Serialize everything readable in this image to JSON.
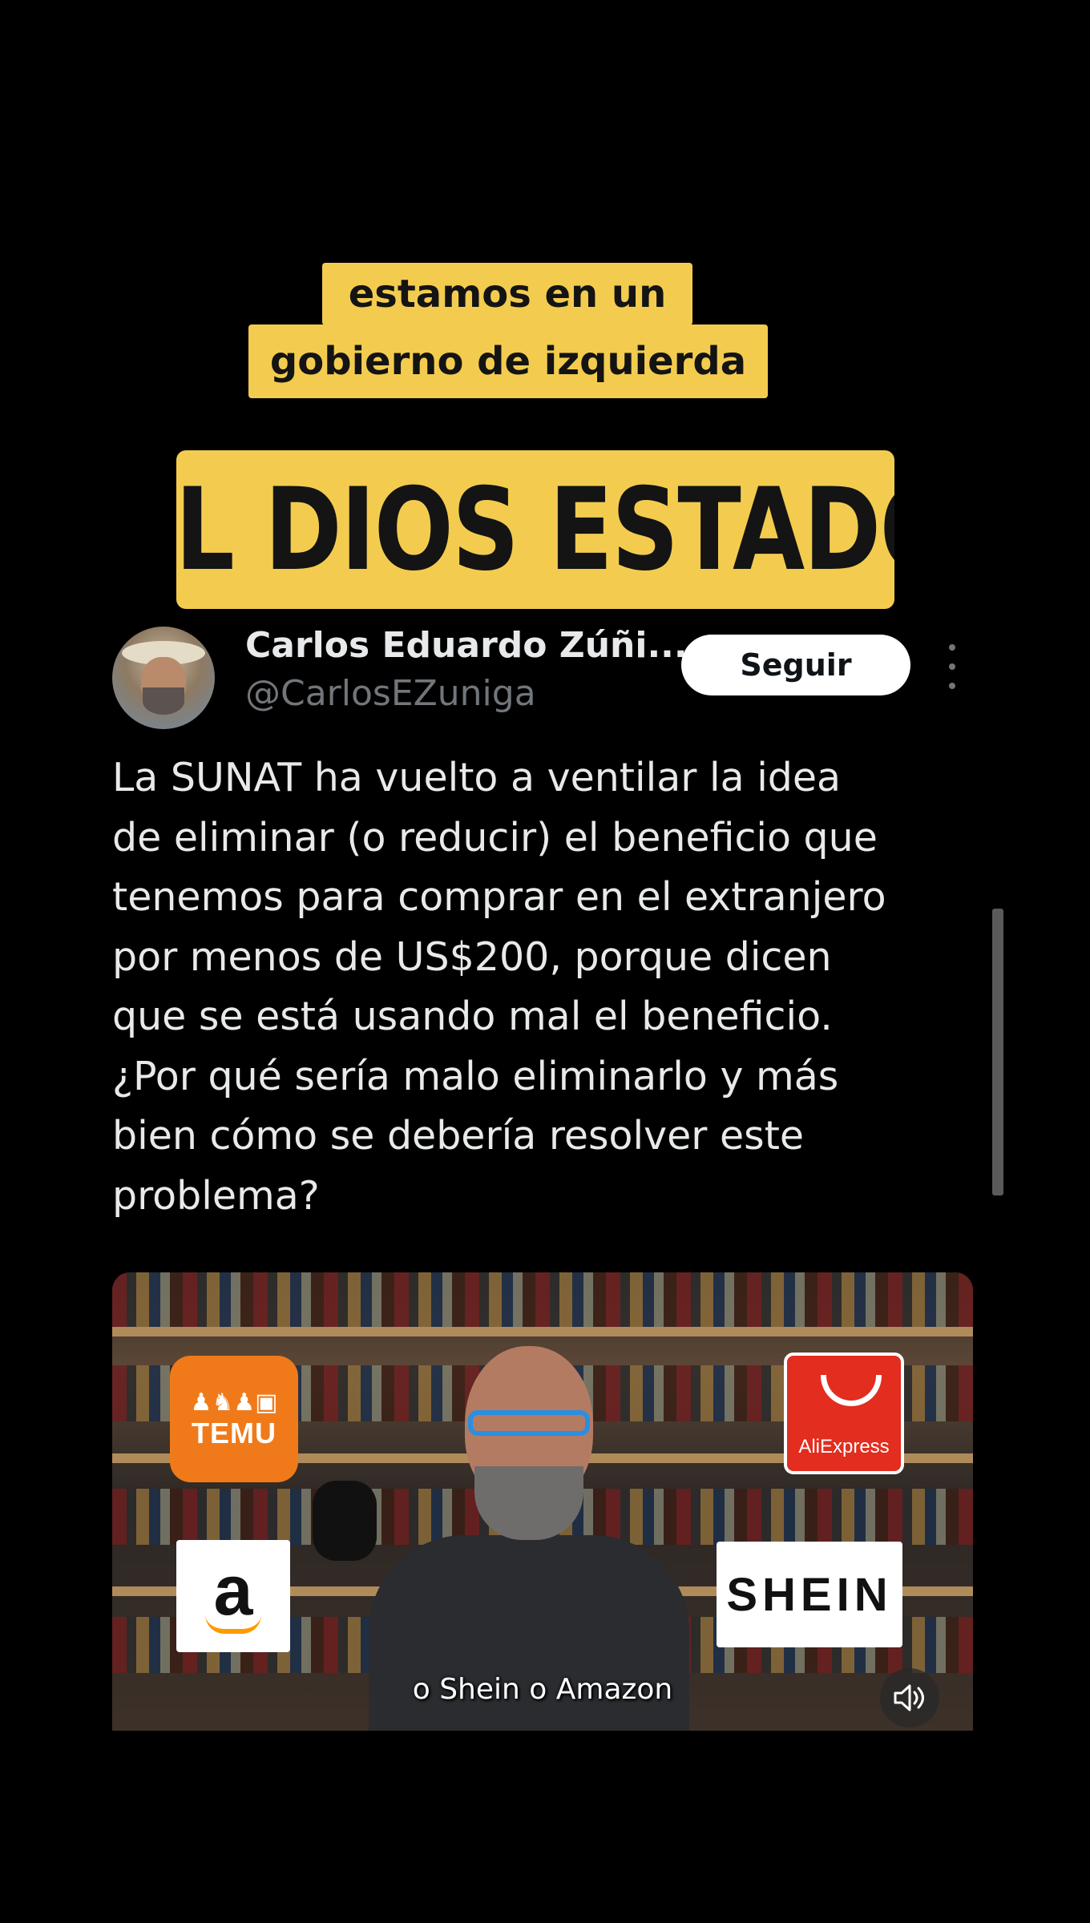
{
  "caption": {
    "lines": [
      "estamos en un",
      "gobierno de izquierda"
    ],
    "headline": "EL DIOS ESTADO"
  },
  "tweet": {
    "author_name": "Carlos Eduardo Zúñi...",
    "author_handle": "@CarlosEZuniga",
    "follow_label": "Seguir",
    "text": "La SUNAT ha vuelto a ventilar la idea\nde eliminar (o reducir) el beneficio que\ntenemos para comprar en el extranjero\npor menos de US$200, porque dicen\nque se está usando mal el beneficio.\n¿Por qué sería malo eliminarlo y más\nbien cómo se debería resolver este\nproblema?"
  },
  "video": {
    "subtitle": "o Shein o Amazon",
    "logos": {
      "temu": "TEMU",
      "aliexpress": "AliExpress",
      "amazon": "a",
      "shein": "SHEIN"
    },
    "mute_icon": "speaker-muted-icon"
  },
  "colors": {
    "caption_bg": "#f3cc4f",
    "follow_bg": "#ffffff",
    "temu": "#f07a1a",
    "aliexpress": "#e22d1f",
    "amazon_arrow": "#ff9900"
  }
}
